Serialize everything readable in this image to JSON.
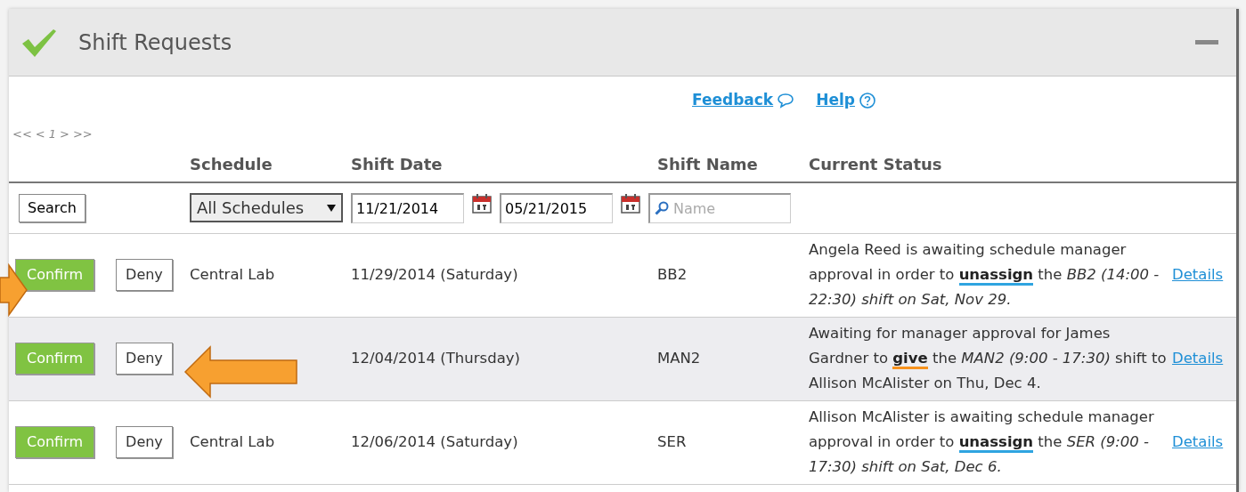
{
  "panel": {
    "title": "Shift Requests"
  },
  "links": [
    {
      "label": "Feedback",
      "kind": "comment"
    },
    {
      "label": "Help",
      "kind": "help"
    }
  ],
  "pager": [
    "<<",
    "<",
    "1",
    ">",
    ">>"
  ],
  "columns": [
    "Schedule",
    "Shift Date",
    "Shift Name",
    "Current Status"
  ],
  "filters": {
    "search_button": "Search",
    "schedule": "All Schedules",
    "date_from": "11/21/2014",
    "date_to": "05/21/2015",
    "name_placeholder": "Name"
  },
  "rows": [
    {
      "selected": false,
      "confirm": "Confirm",
      "deny": "Deny",
      "schedule": "Central Lab",
      "date": "11/29/2014 (Saturday)",
      "shift": "BB2",
      "status": "Angela Reed is awaiting schedule manager approval in order to **unassign** the *BB2 (14:00 - 22:30) shift on Sat, Nov 29.*",
      "color": "#2fa4e0",
      "details": "Details"
    },
    {
      "selected": true,
      "confirm": "Confirm",
      "deny": "Deny",
      "date": "12/04/2014 (Thursday)",
      "shift": "MAN2",
      "status": "Awaiting for manager approval for James Gardner to **give** the *MAN2 (9:00 - 17:30)* shift to Allison McAlister on Thu, Dec 4.",
      "color": "#f7931e",
      "details": "Details"
    },
    {
      "selected": false,
      "confirm": "Confirm",
      "deny": "Deny",
      "schedule": "Central Lab",
      "date": "12/06/2014 (Saturday)",
      "shift": "SER",
      "status": "Allison McAlister is awaiting schedule manager approval in order to **unassign** the *SER (9:00 - 17:30) shift on Sat, Dec 6.*",
      "color": "#2fa4e0",
      "details": "Details"
    }
  ]
}
